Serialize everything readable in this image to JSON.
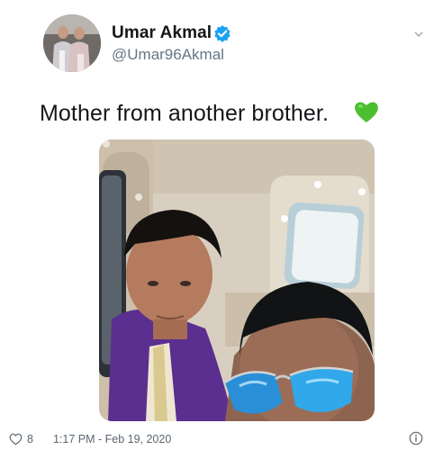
{
  "tweet": {
    "author": {
      "display_name": "Umar Akmal",
      "handle": "@Umar96Akmal",
      "verified": true
    },
    "text": "Mother from another brother.",
    "emoji": "green-heart",
    "likes": "8",
    "timestamp": "1:17 PM - Feb 19, 2020"
  },
  "icons": {
    "verified": "verified-badge-icon",
    "caret": "chevron-down-icon",
    "like": "heart-outline-icon",
    "info": "info-icon",
    "emoji": "green-heart-icon"
  },
  "colors": {
    "verified_blue": "#1da1f2",
    "green_heart": "#4bbf2f",
    "secondary_text": "#657786"
  }
}
